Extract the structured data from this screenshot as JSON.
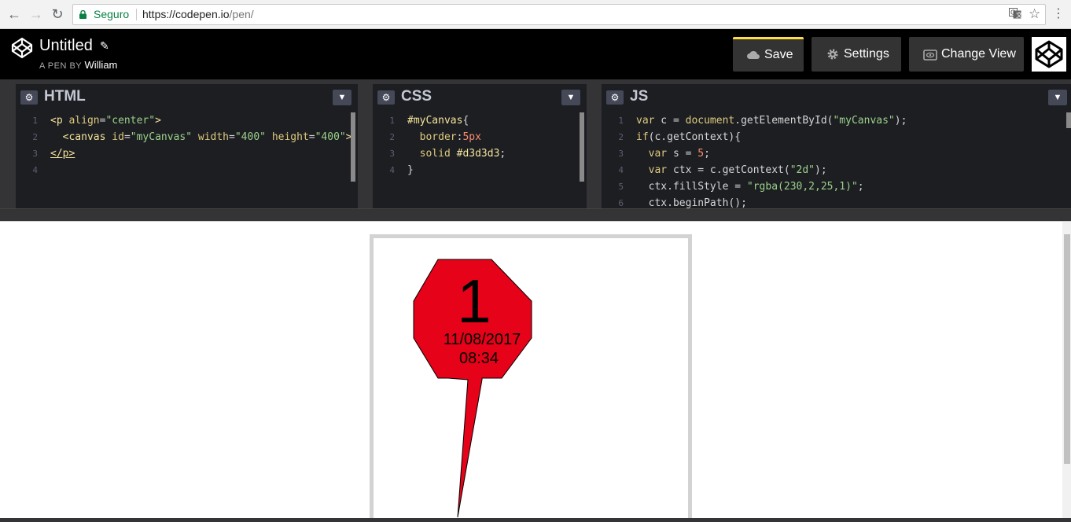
{
  "browser": {
    "secure_label": "Seguro",
    "url_host": "https://codepen.io",
    "url_path": "/pen/"
  },
  "header": {
    "pen_title": "Untitled",
    "byline_prefix": "A PEN BY",
    "author": "William",
    "save_label": "Save",
    "settings_label": "Settings",
    "change_view_label": "Change View",
    "accent": "#ffdd40"
  },
  "editors": {
    "html": {
      "name": "HTML",
      "lines": [
        {
          "n": "1",
          "html": "<span class='tag'>&lt;p</span> <span class='attr'>align</span>=<span class='str'>\"center\"</span><span class='tag'>&gt;</span>"
        },
        {
          "n": "2",
          "html": "  <span class='tag'>&lt;canvas</span> <span class='attr'>id</span>=<span class='str'>\"myCanvas\"</span> <span class='attr'>width</span>=<span class='str'>\"400\"</span> <span class='attr'>height</span>=<span class='str'>\"400\"</span><span class='tag'>&gt;</span>"
        },
        {
          "n": "3",
          "html": "<span class='tag' style='text-decoration:underline'>&lt;/p&gt;</span>"
        },
        {
          "n": "4",
          "html": ""
        }
      ]
    },
    "css": {
      "name": "CSS",
      "lines": [
        {
          "n": "1",
          "html": "<span class='sel'>#myCanvas</span>{"
        },
        {
          "n": "2",
          "html": "  <span class='attr'>border</span>:<span class='num'>5px</span>"
        },
        {
          "n": "3",
          "html": "  <span class='attr'>solid</span> <span class='sel'>#d3d3d3</span>;"
        },
        {
          "n": "4",
          "html": "}"
        }
      ]
    },
    "js": {
      "name": "JS",
      "lines": [
        {
          "n": "1",
          "html": "<span class='kw'>var</span> c = <span class='attr'>document</span>.<span class='prop'>getElementById</span>(<span class='str'>\"myCanvas\"</span>);"
        },
        {
          "n": "2",
          "html": "<span class='kw'>if</span>(c.<span class='prop'>getContext</span>){"
        },
        {
          "n": "3",
          "html": "  <span class='kw'>var</span> s = <span class='num'>5</span>;"
        },
        {
          "n": "4",
          "html": "  <span class='kw'>var</span> ctx = c.<span class='prop'>getContext</span>(<span class='str'>\"2d\"</span>);"
        },
        {
          "n": "5",
          "html": "  ctx.<span class='prop'>fillStyle</span> = <span class='str'>\"rgba(230,2,25,1)\"</span>;"
        },
        {
          "n": "6",
          "html": "  ctx.<span class='prop'>beginPath</span>();"
        }
      ]
    }
  },
  "preview": {
    "marker_number": "1",
    "marker_date": "11/08/2017",
    "marker_time": "08:34",
    "marker_color": "#e60219"
  }
}
